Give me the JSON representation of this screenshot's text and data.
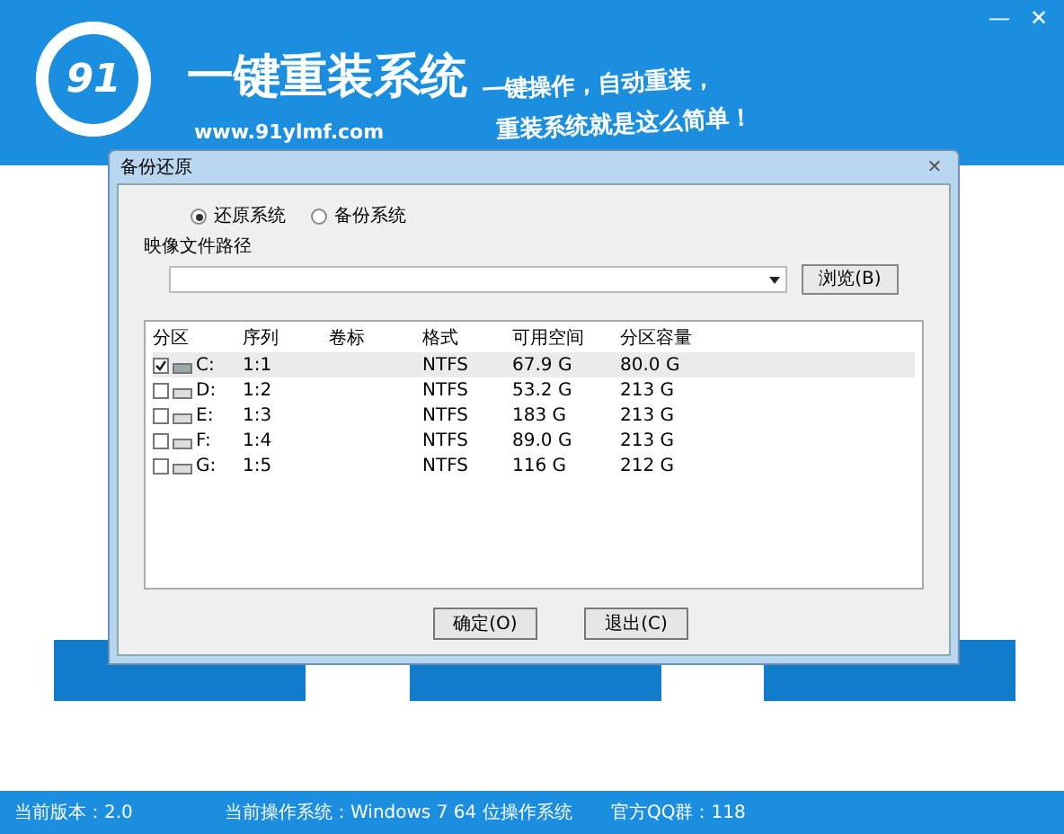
{
  "app": {
    "logo": "91",
    "title": "一键重装系统",
    "url": "www.91ylmf.com",
    "slogan_lines": [
      "一键操作，自动重装，",
      "重装系统就是这么简单！"
    ]
  },
  "window_controls": [
    "—",
    "✕"
  ],
  "dialog": {
    "title": "备份还原",
    "close": "✕",
    "modes": [
      {
        "label": "还原系统",
        "selected": true
      },
      {
        "label": "备份系统",
        "selected": false
      }
    ],
    "path_label": "映像文件路径",
    "browse": "浏览(B)",
    "table": {
      "columns": [
        "分区",
        "序列",
        "卷标",
        "格式",
        "可用空间",
        "分区容量"
      ],
      "rows": [
        {
          "checked": true,
          "selected": true,
          "drive": "C:",
          "order": "1:1",
          "format": "NTFS",
          "free": "67.9 G",
          "size": "80.0 G",
          "system": true
        },
        {
          "checked": false,
          "selected": false,
          "drive": "D:",
          "order": "1:2",
          "format": "NTFS",
          "free": "53.2 G",
          "size": "213 G",
          "system": false
        },
        {
          "checked": false,
          "selected": false,
          "drive": "E:",
          "order": "1:3",
          "format": "NTFS",
          "free": "183 G",
          "size": "213 G",
          "system": false
        },
        {
          "checked": false,
          "selected": false,
          "drive": "F:",
          "order": "1:4",
          "format": "NTFS",
          "free": "89.0 G",
          "size": "213 G",
          "system": false
        },
        {
          "checked": false,
          "selected": false,
          "drive": "G:",
          "order": "1:5",
          "format": "NTFS",
          "free": "116 G",
          "size": "212 G",
          "system": false
        }
      ]
    },
    "buttons": [
      "确定(O)",
      "退出(C)"
    ]
  },
  "status_bar": [
    "当前版本：2.0",
    "当前操作系统：Windows 7 64 位操作系统",
    "官方QQ群：118"
  ]
}
